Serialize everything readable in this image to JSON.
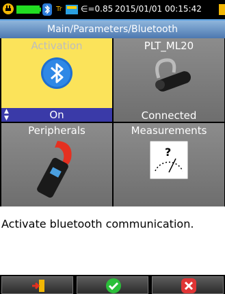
{
  "status": {
    "ratio_label": "∈=0.85",
    "datetime": "2015/01/01 00:15:42"
  },
  "path": "Main/Parameters/Bluetooth",
  "tiles": [
    {
      "title": "Activation",
      "value": "On",
      "icon": "bluetooth-icon"
    },
    {
      "title": "PLT_ML20",
      "value": "Connected",
      "icon": "headset-icon"
    },
    {
      "title": "Peripherals",
      "icon": "clamp-meter-icon"
    },
    {
      "title": "Measurements",
      "icon": "gauge-icon"
    }
  ],
  "description": "Activate bluetooth communication.",
  "softkeys": [
    "exit-icon",
    "confirm-check-icon",
    "cancel-x-icon"
  ]
}
